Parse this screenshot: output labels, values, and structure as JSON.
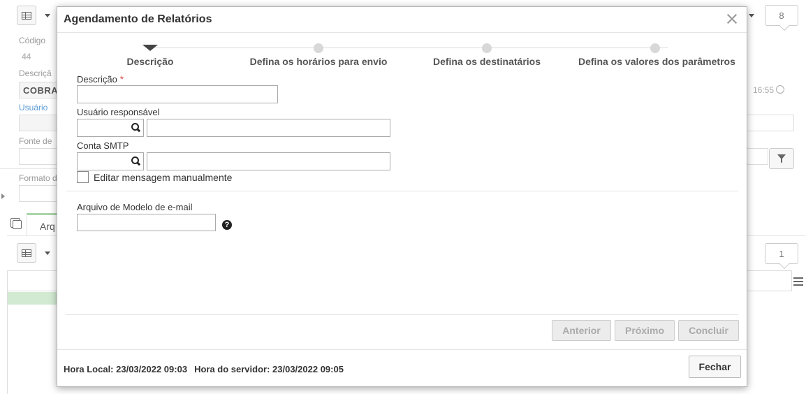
{
  "background": {
    "top_count": "8",
    "bottom_count": "1",
    "fields": {
      "codigo_label": "Código",
      "codigo_value": "44",
      "descricao_label": "Descriçã",
      "descricao_value": "COBRA",
      "usuario_label": "Usuário",
      "fonte_label": "Fonte de",
      "formato_label": "Formato d"
    },
    "tab_label": "Arq",
    "time_text": "16:55"
  },
  "modal": {
    "title": "Agendamento de Relatórios",
    "steps": [
      {
        "label": "Descrição",
        "active": true
      },
      {
        "label": "Defina os horários para envio",
        "active": false
      },
      {
        "label": "Defina os destinatários",
        "active": false
      },
      {
        "label": "Defina os valores dos parâmetros",
        "active": false
      }
    ],
    "form": {
      "descricao_label": "Descrição",
      "required_mark": "*",
      "descricao_value": "",
      "usuario_label": "Usuário responsável",
      "smtp_label": "Conta SMTP",
      "editar_label": "Editar mensagem manualmente",
      "editar_checked": false,
      "arquivo_label": "Arquivo de Modelo de e-mail",
      "help_glyph": "?"
    },
    "buttons": {
      "anterior": "Anterior",
      "proximo": "Próximo",
      "concluir": "Concluir",
      "fechar": "Fechar"
    },
    "footer": {
      "hora_local": "Hora Local: 23/03/2022 09:03",
      "hora_servidor": "Hora do servidor: 23/03/2022 09:05"
    }
  }
}
